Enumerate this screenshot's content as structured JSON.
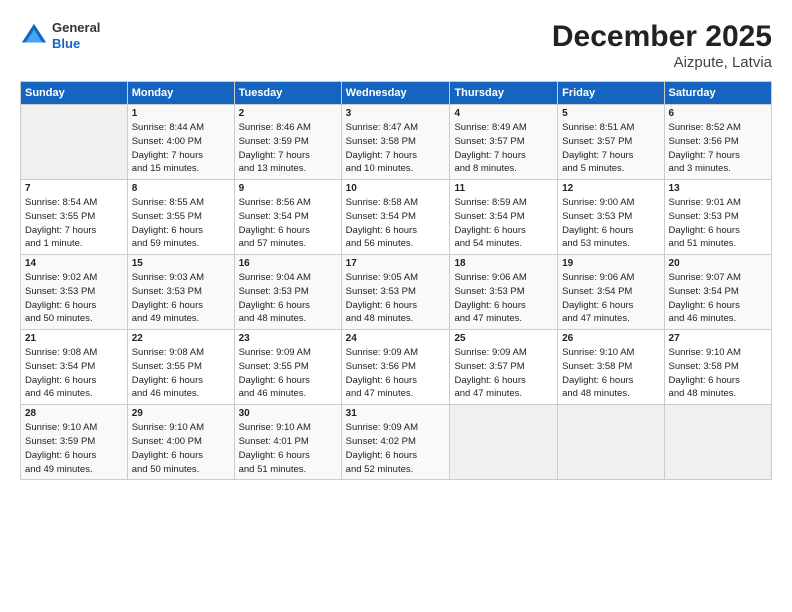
{
  "header": {
    "logo_general": "General",
    "logo_blue": "Blue",
    "title": "December 2025",
    "subtitle": "Aizpute, Latvia"
  },
  "columns": [
    "Sunday",
    "Monday",
    "Tuesday",
    "Wednesday",
    "Thursday",
    "Friday",
    "Saturday"
  ],
  "weeks": [
    [
      {
        "day": "",
        "info": ""
      },
      {
        "day": "1",
        "info": "Sunrise: 8:44 AM\nSunset: 4:00 PM\nDaylight: 7 hours\nand 15 minutes."
      },
      {
        "day": "2",
        "info": "Sunrise: 8:46 AM\nSunset: 3:59 PM\nDaylight: 7 hours\nand 13 minutes."
      },
      {
        "day": "3",
        "info": "Sunrise: 8:47 AM\nSunset: 3:58 PM\nDaylight: 7 hours\nand 10 minutes."
      },
      {
        "day": "4",
        "info": "Sunrise: 8:49 AM\nSunset: 3:57 PM\nDaylight: 7 hours\nand 8 minutes."
      },
      {
        "day": "5",
        "info": "Sunrise: 8:51 AM\nSunset: 3:57 PM\nDaylight: 7 hours\nand 5 minutes."
      },
      {
        "day": "6",
        "info": "Sunrise: 8:52 AM\nSunset: 3:56 PM\nDaylight: 7 hours\nand 3 minutes."
      }
    ],
    [
      {
        "day": "7",
        "info": "Sunrise: 8:54 AM\nSunset: 3:55 PM\nDaylight: 7 hours\nand 1 minute."
      },
      {
        "day": "8",
        "info": "Sunrise: 8:55 AM\nSunset: 3:55 PM\nDaylight: 6 hours\nand 59 minutes."
      },
      {
        "day": "9",
        "info": "Sunrise: 8:56 AM\nSunset: 3:54 PM\nDaylight: 6 hours\nand 57 minutes."
      },
      {
        "day": "10",
        "info": "Sunrise: 8:58 AM\nSunset: 3:54 PM\nDaylight: 6 hours\nand 56 minutes."
      },
      {
        "day": "11",
        "info": "Sunrise: 8:59 AM\nSunset: 3:54 PM\nDaylight: 6 hours\nand 54 minutes."
      },
      {
        "day": "12",
        "info": "Sunrise: 9:00 AM\nSunset: 3:53 PM\nDaylight: 6 hours\nand 53 minutes."
      },
      {
        "day": "13",
        "info": "Sunrise: 9:01 AM\nSunset: 3:53 PM\nDaylight: 6 hours\nand 51 minutes."
      }
    ],
    [
      {
        "day": "14",
        "info": "Sunrise: 9:02 AM\nSunset: 3:53 PM\nDaylight: 6 hours\nand 50 minutes."
      },
      {
        "day": "15",
        "info": "Sunrise: 9:03 AM\nSunset: 3:53 PM\nDaylight: 6 hours\nand 49 minutes."
      },
      {
        "day": "16",
        "info": "Sunrise: 9:04 AM\nSunset: 3:53 PM\nDaylight: 6 hours\nand 48 minutes."
      },
      {
        "day": "17",
        "info": "Sunrise: 9:05 AM\nSunset: 3:53 PM\nDaylight: 6 hours\nand 48 minutes."
      },
      {
        "day": "18",
        "info": "Sunrise: 9:06 AM\nSunset: 3:53 PM\nDaylight: 6 hours\nand 47 minutes."
      },
      {
        "day": "19",
        "info": "Sunrise: 9:06 AM\nSunset: 3:54 PM\nDaylight: 6 hours\nand 47 minutes."
      },
      {
        "day": "20",
        "info": "Sunrise: 9:07 AM\nSunset: 3:54 PM\nDaylight: 6 hours\nand 46 minutes."
      }
    ],
    [
      {
        "day": "21",
        "info": "Sunrise: 9:08 AM\nSunset: 3:54 PM\nDaylight: 6 hours\nand 46 minutes."
      },
      {
        "day": "22",
        "info": "Sunrise: 9:08 AM\nSunset: 3:55 PM\nDaylight: 6 hours\nand 46 minutes."
      },
      {
        "day": "23",
        "info": "Sunrise: 9:09 AM\nSunset: 3:55 PM\nDaylight: 6 hours\nand 46 minutes."
      },
      {
        "day": "24",
        "info": "Sunrise: 9:09 AM\nSunset: 3:56 PM\nDaylight: 6 hours\nand 47 minutes."
      },
      {
        "day": "25",
        "info": "Sunrise: 9:09 AM\nSunset: 3:57 PM\nDaylight: 6 hours\nand 47 minutes."
      },
      {
        "day": "26",
        "info": "Sunrise: 9:10 AM\nSunset: 3:58 PM\nDaylight: 6 hours\nand 48 minutes."
      },
      {
        "day": "27",
        "info": "Sunrise: 9:10 AM\nSunset: 3:58 PM\nDaylight: 6 hours\nand 48 minutes."
      }
    ],
    [
      {
        "day": "28",
        "info": "Sunrise: 9:10 AM\nSunset: 3:59 PM\nDaylight: 6 hours\nand 49 minutes."
      },
      {
        "day": "29",
        "info": "Sunrise: 9:10 AM\nSunset: 4:00 PM\nDaylight: 6 hours\nand 50 minutes."
      },
      {
        "day": "30",
        "info": "Sunrise: 9:10 AM\nSunset: 4:01 PM\nDaylight: 6 hours\nand 51 minutes."
      },
      {
        "day": "31",
        "info": "Sunrise: 9:09 AM\nSunset: 4:02 PM\nDaylight: 6 hours\nand 52 minutes."
      },
      {
        "day": "",
        "info": ""
      },
      {
        "day": "",
        "info": ""
      },
      {
        "day": "",
        "info": ""
      }
    ]
  ]
}
